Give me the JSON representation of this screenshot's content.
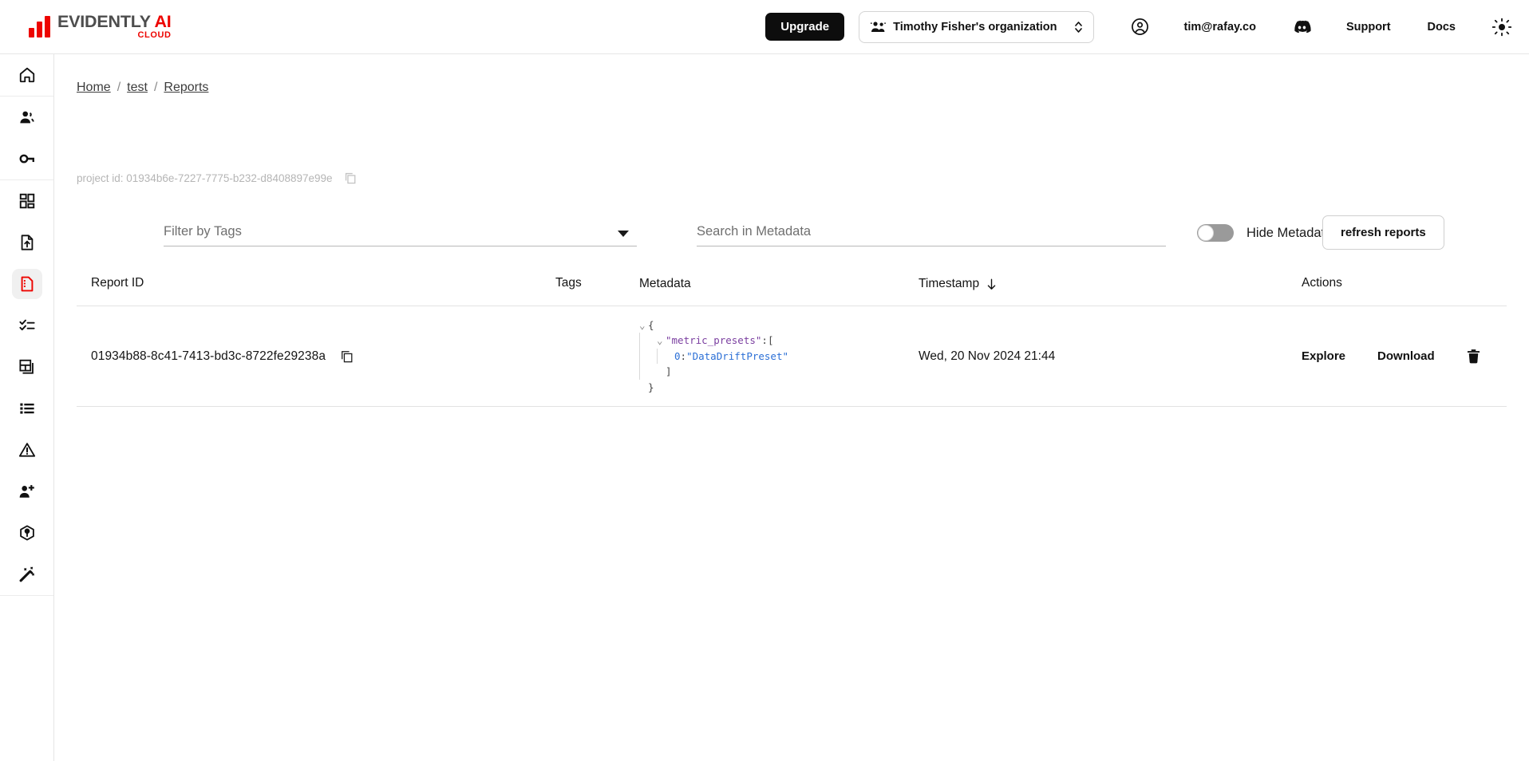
{
  "brand": {
    "name_main": "EVIDENTLY",
    "name_ai": "AI",
    "sub": "CLOUD",
    "accent": "#ed0400"
  },
  "topbar": {
    "upgrade_label": "Upgrade",
    "org_name": "Timothy Fisher's organization",
    "user_email": "tim@rafay.co",
    "support_label": "Support",
    "docs_label": "Docs",
    "icons": {
      "org": "people-icon",
      "account": "user-circle-icon",
      "support": "discord-icon",
      "theme": "sun-icon"
    }
  },
  "sidebar": {
    "items": [
      {
        "name": "home",
        "icon": "home-icon",
        "active": false
      },
      {
        "name": "team",
        "icon": "users-icon",
        "active": false
      },
      {
        "name": "api-keys",
        "icon": "key-icon",
        "active": false
      },
      {
        "name": "dashboards",
        "icon": "dashboard-grid-icon",
        "active": false
      },
      {
        "name": "upload",
        "icon": "file-upload-icon",
        "active": false
      },
      {
        "name": "reports",
        "icon": "report-file-icon",
        "active": true
      },
      {
        "name": "test-suites",
        "icon": "checklist-icon",
        "active": false
      },
      {
        "name": "snapshots",
        "icon": "panels-icon",
        "active": false
      },
      {
        "name": "datasets",
        "icon": "list-icon",
        "active": false
      },
      {
        "name": "alerts",
        "icon": "warning-triangle-icon",
        "active": false
      },
      {
        "name": "invite",
        "icon": "user-plus-icon",
        "active": false
      },
      {
        "name": "models",
        "icon": "cube-icon",
        "active": false
      },
      {
        "name": "magic",
        "icon": "magic-wand-icon",
        "active": false
      }
    ]
  },
  "breadcrumb": {
    "home": "Home",
    "project": "test",
    "current": "Reports",
    "separator": "/"
  },
  "project": {
    "id_label": "project id: 01934b6e-7227-7775-b232-d8408897e99e",
    "copy_icon": "copy-icon"
  },
  "toolbar": {
    "tags_placeholder": "Filter by Tags",
    "tags_value": "",
    "metadata_placeholder": "Search in Metadata",
    "metadata_value": "",
    "hide_metadata_label": "Hide Metadata",
    "hide_metadata_on": false,
    "refresh_label": "refresh reports"
  },
  "table": {
    "headers": {
      "report_id": "Report ID",
      "tags": "Tags",
      "metadata": "Metadata",
      "timestamp": "Timestamp",
      "sort_icon": "arrow-down-icon",
      "actions": "Actions"
    },
    "rows": [
      {
        "report_id": "01934b88-8c41-7413-bd3c-8722fe29238a",
        "tags": "",
        "metadata_json": {
          "line_open": "{",
          "key": "\"metric_presets\"",
          "key_colon": ":",
          "array_open": "[",
          "index": "0",
          "index_colon": ":",
          "value": "\"DataDriftPreset\"",
          "array_close": "]",
          "line_close": "}"
        },
        "timestamp": "Wed, 20 Nov 2024 21:44",
        "actions": {
          "explore": "Explore",
          "download": "Download",
          "delete_icon": "trash-icon"
        }
      }
    ]
  }
}
